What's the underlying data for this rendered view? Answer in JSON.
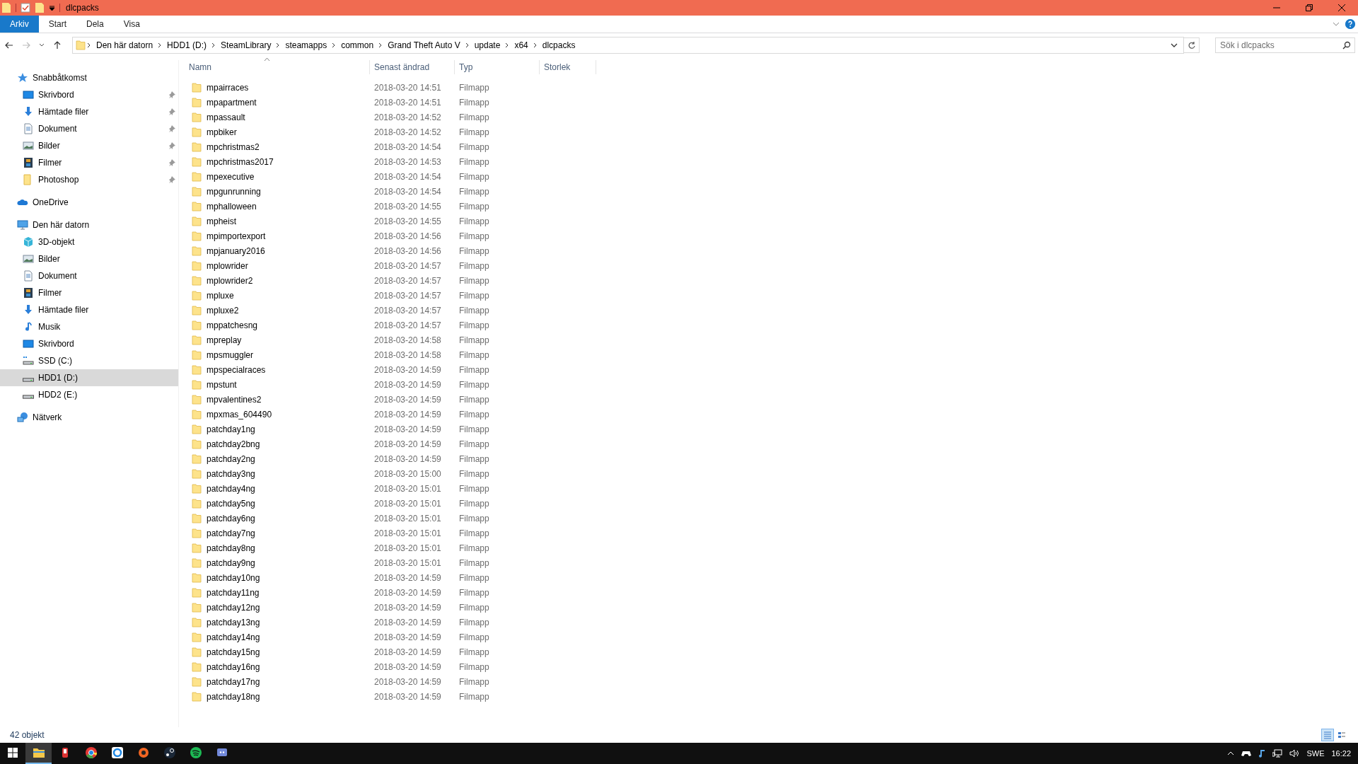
{
  "window": {
    "title": "dlcpacks"
  },
  "ribbon_tabs": [
    {
      "label": "Arkiv",
      "selected": true
    },
    {
      "label": "Start",
      "selected": false
    },
    {
      "label": "Dela",
      "selected": false
    },
    {
      "label": "Visa",
      "selected": false
    }
  ],
  "address": {
    "crumbs": [
      "Den här datorn",
      "HDD1 (D:)",
      "SteamLibrary",
      "steamapps",
      "common",
      "Grand Theft Auto V",
      "update",
      "x64",
      "dlcpacks"
    ]
  },
  "search": {
    "placeholder": "Sök i dlcpacks"
  },
  "sidebar": {
    "items": [
      {
        "label": "Snabbåtkomst",
        "kind": "star",
        "selected": false,
        "children": [
          {
            "label": "Skrivbord",
            "kind": "desktop",
            "pinned": true,
            "selected": false
          },
          {
            "label": "Hämtade filer",
            "kind": "download",
            "pinned": true,
            "selected": false
          },
          {
            "label": "Dokument",
            "kind": "document",
            "pinned": true,
            "selected": false
          },
          {
            "label": "Bilder",
            "kind": "pictures",
            "pinned": true,
            "selected": false
          },
          {
            "label": "Filmer",
            "kind": "film",
            "pinned": true,
            "selected": false
          },
          {
            "label": "Photoshop",
            "kind": "folder",
            "pinned": true,
            "selected": false
          }
        ]
      },
      {
        "label": "OneDrive",
        "kind": "cloud",
        "selected": false
      },
      {
        "label": "Den här datorn",
        "kind": "computer",
        "selected": false,
        "children": [
          {
            "label": "3D-objekt",
            "kind": "cube",
            "pinned": false,
            "selected": false
          },
          {
            "label": "Bilder",
            "kind": "pictures",
            "pinned": false,
            "selected": false
          },
          {
            "label": "Dokument",
            "kind": "document",
            "pinned": false,
            "selected": false
          },
          {
            "label": "Filmer",
            "kind": "film",
            "pinned": false,
            "selected": false
          },
          {
            "label": "Hämtade filer",
            "kind": "download",
            "pinned": false,
            "selected": false
          },
          {
            "label": "Musik",
            "kind": "music",
            "pinned": false,
            "selected": false
          },
          {
            "label": "Skrivbord",
            "kind": "desktop",
            "pinned": false,
            "selected": false
          },
          {
            "label": "SSD (C:)",
            "kind": "osdrive",
            "pinned": false,
            "selected": false
          },
          {
            "label": "HDD1 (D:)",
            "kind": "drive",
            "pinned": false,
            "selected": true
          },
          {
            "label": "HDD2 (E:)",
            "kind": "drive",
            "pinned": false,
            "selected": false
          }
        ]
      },
      {
        "label": "Nätverk",
        "kind": "network",
        "selected": false
      }
    ]
  },
  "table": {
    "columns": [
      {
        "label": "Namn",
        "sorted": true
      },
      {
        "label": "Senast ändrad",
        "sorted": false
      },
      {
        "label": "Typ",
        "sorted": false
      },
      {
        "label": "Storlek",
        "sorted": false
      }
    ],
    "rows": [
      {
        "name": "mpairraces",
        "modified": "2018-03-20 14:51",
        "type": "Filmapp"
      },
      {
        "name": "mpapartment",
        "modified": "2018-03-20 14:51",
        "type": "Filmapp"
      },
      {
        "name": "mpassault",
        "modified": "2018-03-20 14:52",
        "type": "Filmapp"
      },
      {
        "name": "mpbiker",
        "modified": "2018-03-20 14:52",
        "type": "Filmapp"
      },
      {
        "name": "mpchristmas2",
        "modified": "2018-03-20 14:54",
        "type": "Filmapp"
      },
      {
        "name": "mpchristmas2017",
        "modified": "2018-03-20 14:53",
        "type": "Filmapp"
      },
      {
        "name": "mpexecutive",
        "modified": "2018-03-20 14:54",
        "type": "Filmapp"
      },
      {
        "name": "mpgunrunning",
        "modified": "2018-03-20 14:54",
        "type": "Filmapp"
      },
      {
        "name": "mphalloween",
        "modified": "2018-03-20 14:55",
        "type": "Filmapp"
      },
      {
        "name": "mpheist",
        "modified": "2018-03-20 14:55",
        "type": "Filmapp"
      },
      {
        "name": "mpimportexport",
        "modified": "2018-03-20 14:56",
        "type": "Filmapp"
      },
      {
        "name": "mpjanuary2016",
        "modified": "2018-03-20 14:56",
        "type": "Filmapp"
      },
      {
        "name": "mplowrider",
        "modified": "2018-03-20 14:57",
        "type": "Filmapp"
      },
      {
        "name": "mplowrider2",
        "modified": "2018-03-20 14:57",
        "type": "Filmapp"
      },
      {
        "name": "mpluxe",
        "modified": "2018-03-20 14:57",
        "type": "Filmapp"
      },
      {
        "name": "mpluxe2",
        "modified": "2018-03-20 14:57",
        "type": "Filmapp"
      },
      {
        "name": "mppatchesng",
        "modified": "2018-03-20 14:57",
        "type": "Filmapp"
      },
      {
        "name": "mpreplay",
        "modified": "2018-03-20 14:58",
        "type": "Filmapp"
      },
      {
        "name": "mpsmuggler",
        "modified": "2018-03-20 14:58",
        "type": "Filmapp"
      },
      {
        "name": "mpspecialraces",
        "modified": "2018-03-20 14:59",
        "type": "Filmapp"
      },
      {
        "name": "mpstunt",
        "modified": "2018-03-20 14:59",
        "type": "Filmapp"
      },
      {
        "name": "mpvalentines2",
        "modified": "2018-03-20 14:59",
        "type": "Filmapp"
      },
      {
        "name": "mpxmas_604490",
        "modified": "2018-03-20 14:59",
        "type": "Filmapp"
      },
      {
        "name": "patchday1ng",
        "modified": "2018-03-20 14:59",
        "type": "Filmapp"
      },
      {
        "name": "patchday2bng",
        "modified": "2018-03-20 14:59",
        "type": "Filmapp"
      },
      {
        "name": "patchday2ng",
        "modified": "2018-03-20 14:59",
        "type": "Filmapp"
      },
      {
        "name": "patchday3ng",
        "modified": "2018-03-20 15:00",
        "type": "Filmapp"
      },
      {
        "name": "patchday4ng",
        "modified": "2018-03-20 15:01",
        "type": "Filmapp"
      },
      {
        "name": "patchday5ng",
        "modified": "2018-03-20 15:01",
        "type": "Filmapp"
      },
      {
        "name": "patchday6ng",
        "modified": "2018-03-20 15:01",
        "type": "Filmapp"
      },
      {
        "name": "patchday7ng",
        "modified": "2018-03-20 15:01",
        "type": "Filmapp"
      },
      {
        "name": "patchday8ng",
        "modified": "2018-03-20 15:01",
        "type": "Filmapp"
      },
      {
        "name": "patchday9ng",
        "modified": "2018-03-20 15:01",
        "type": "Filmapp"
      },
      {
        "name": "patchday10ng",
        "modified": "2018-03-20 14:59",
        "type": "Filmapp"
      },
      {
        "name": "patchday11ng",
        "modified": "2018-03-20 14:59",
        "type": "Filmapp"
      },
      {
        "name": "patchday12ng",
        "modified": "2018-03-20 14:59",
        "type": "Filmapp"
      },
      {
        "name": "patchday13ng",
        "modified": "2018-03-20 14:59",
        "type": "Filmapp"
      },
      {
        "name": "patchday14ng",
        "modified": "2018-03-20 14:59",
        "type": "Filmapp"
      },
      {
        "name": "patchday15ng",
        "modified": "2018-03-20 14:59",
        "type": "Filmapp"
      },
      {
        "name": "patchday16ng",
        "modified": "2018-03-20 14:59",
        "type": "Filmapp"
      },
      {
        "name": "patchday17ng",
        "modified": "2018-03-20 14:59",
        "type": "Filmapp"
      },
      {
        "name": "patchday18ng",
        "modified": "2018-03-20 14:59",
        "type": "Filmapp"
      }
    ]
  },
  "status_bar": {
    "count": "42 objekt",
    "views": [
      {
        "kind": "details",
        "selected": true
      },
      {
        "kind": "tiles",
        "selected": false
      }
    ]
  },
  "taskbar": {
    "apps": [
      {
        "kind": "explorer",
        "selected": true
      },
      {
        "kind": "app-red",
        "selected": false
      },
      {
        "kind": "browser",
        "selected": false
      },
      {
        "kind": "app-blue",
        "selected": false
      },
      {
        "kind": "app-orange",
        "selected": false
      },
      {
        "kind": "steam",
        "selected": false
      },
      {
        "kind": "spotify",
        "selected": false
      },
      {
        "kind": "chat",
        "selected": false
      }
    ],
    "language": "SWE",
    "clock": "16:22"
  }
}
